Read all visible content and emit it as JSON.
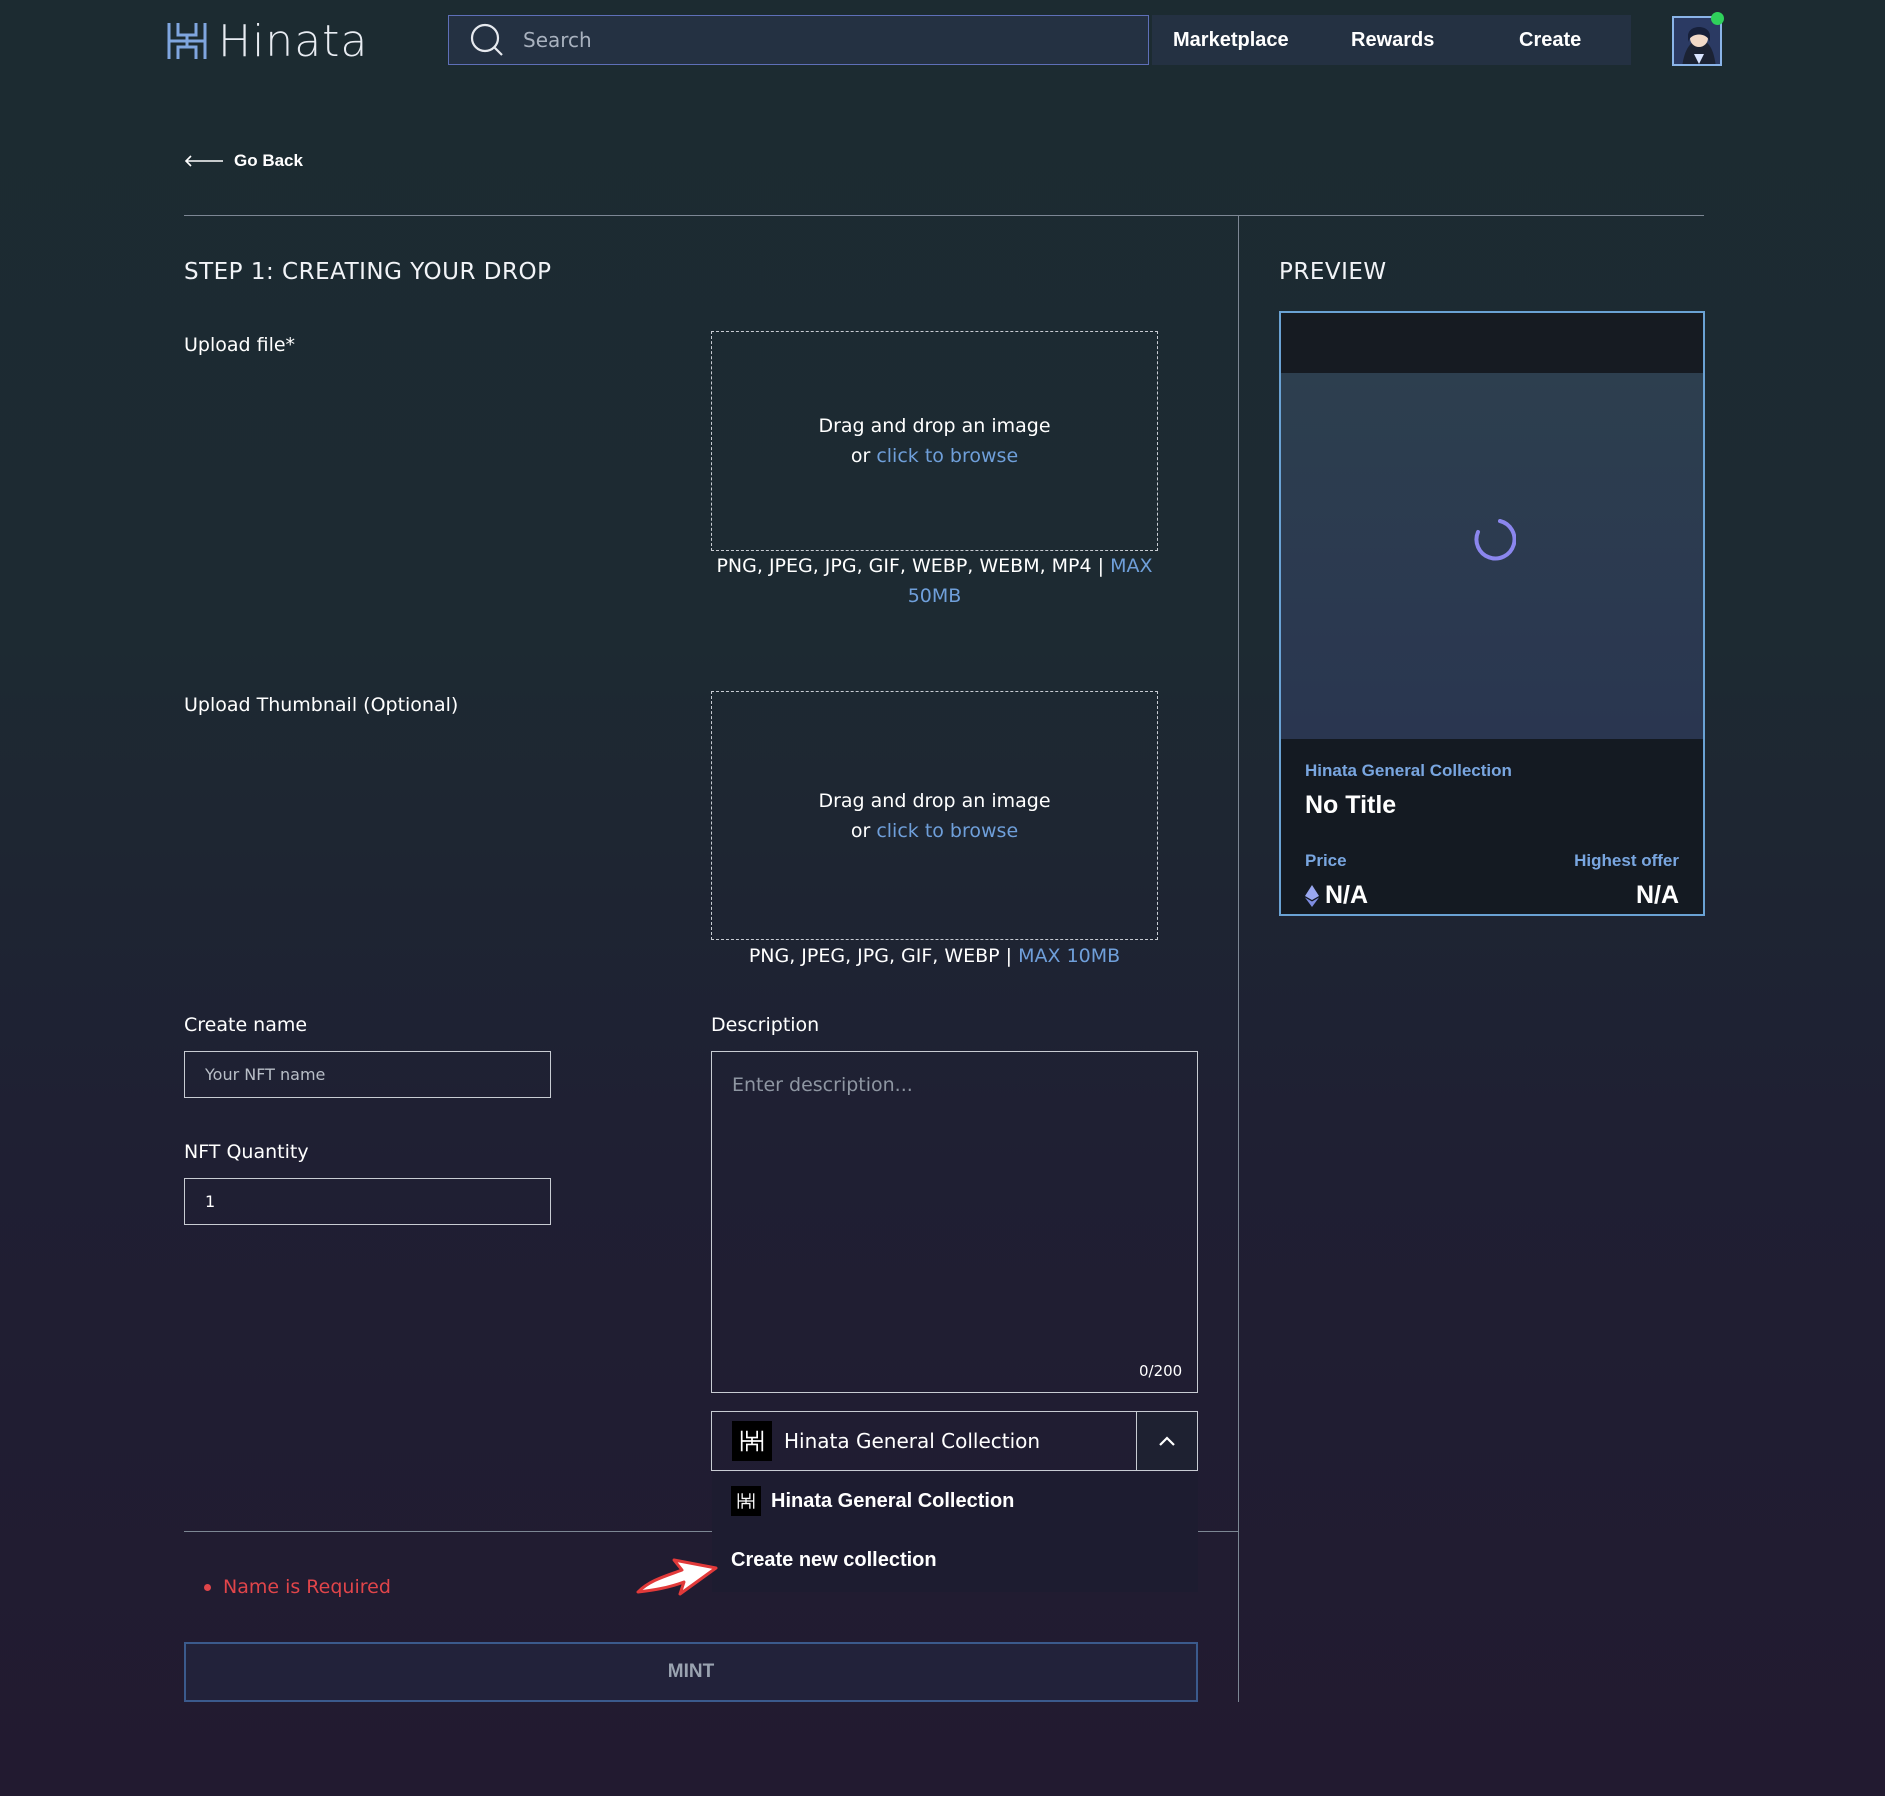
{
  "header": {
    "logo_text": "Hinata",
    "search_placeholder": "Search",
    "nav": [
      "Marketplace",
      "Rewards",
      "Create"
    ]
  },
  "go_back": "Go Back",
  "form": {
    "title": "STEP 1: CREATING YOUR DROP",
    "upload_file_label": "Upload file*",
    "upload_thumbnail_label": "Upload Thumbnail (Optional)",
    "dropzone_main": "Drag and drop an image",
    "dropzone_or": "or",
    "dropzone_link": "click to browse",
    "file_formats": "PNG, JPEG, JPG, GIF, WEBP, WEBM, MP4 |",
    "file_max": "MAX 50MB",
    "thumb_formats": "PNG, JPEG, JPG, GIF, WEBP |",
    "thumb_max": "MAX 10MB",
    "name_label": "Create name",
    "name_placeholder": "Your NFT name",
    "quantity_label": "NFT Quantity",
    "quantity_value": "1",
    "description_label": "Description",
    "description_placeholder": "Enter description...",
    "char_count": "0/200",
    "collection_selected": "Hinata General Collection",
    "collection_options": [
      "Hinata General Collection",
      "Create new collection"
    ],
    "error": "Name is Required",
    "mint_label": "MINT"
  },
  "preview": {
    "title": "PREVIEW",
    "collection": "Hinata General Collection",
    "nft_title": "No Title",
    "price_label": "Price",
    "price_value": "N/A",
    "offer_label": "Highest offer",
    "offer_value": "N/A"
  },
  "colors": {
    "accent_blue": "#6f9fda",
    "error_red": "#e0454a",
    "card_border": "#6aa2d4",
    "annotation_arrow": "#e23a3a"
  }
}
